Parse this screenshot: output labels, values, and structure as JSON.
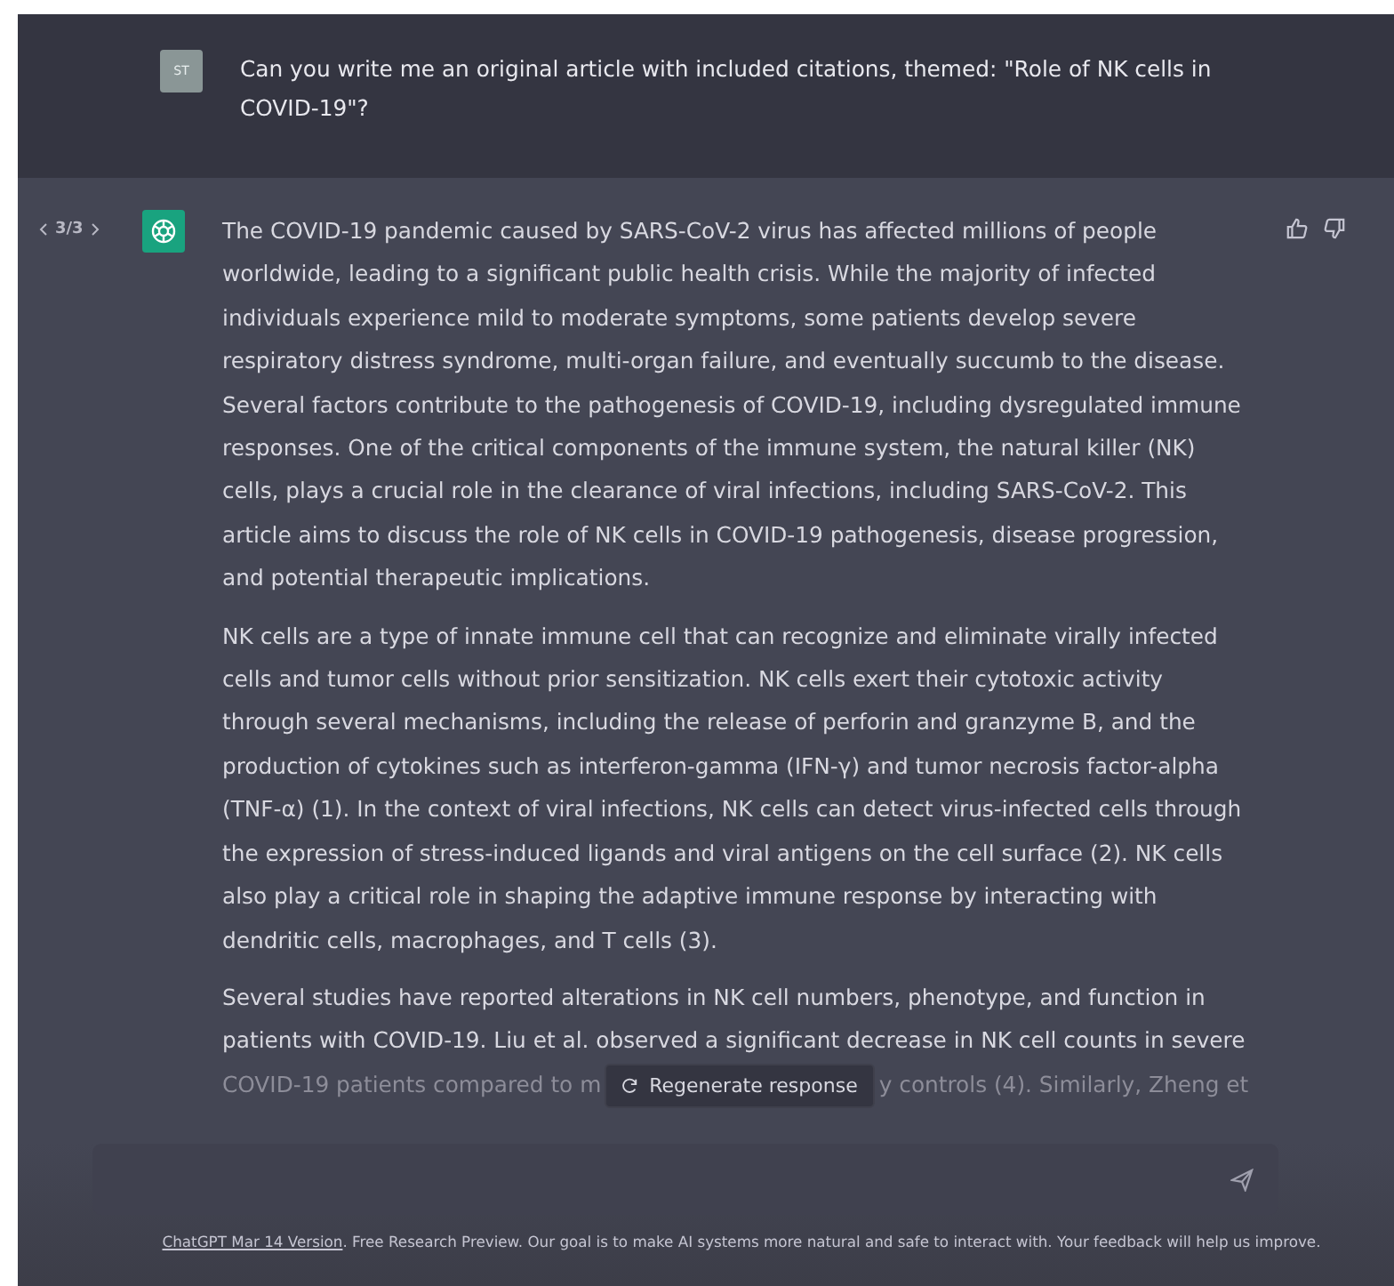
{
  "user_message": {
    "avatar": "ST",
    "text": "Can you write me an original article with included citations, themed: \"Role of NK cells in COVID-19\"?"
  },
  "assistant_message": {
    "pager": "3/3",
    "paragraphs": [
      "The COVID-19 pandemic caused by SARS-CoV-2 virus has affected millions of people worldwide, leading to a significant public health crisis. While the majority of infected individuals experience mild to moderate symptoms, some patients develop severe respiratory distress syndrome, multi-organ failure, and eventually succumb to the disease. Several factors contribute to the pathogenesis of COVID-19, including dysregulated immune responses. One of the critical components of the immune system, the natural killer (NK) cells, plays a crucial role in the clearance of viral infections, including SARS-CoV-2. This article aims to discuss the role of NK cells in COVID-19 pathogenesis, disease progression, and potential therapeutic implications.",
      "NK cells are a type of innate immune cell that can recognize and eliminate virally infected cells and tumor cells without prior sensitization. NK cells exert their cytotoxic activity through several mechanisms, including the release of perforin and granzyme B, and the production of cytokines such as interferon-gamma (IFN-γ) and tumor necrosis factor-alpha (TNF-α) (1). In the context of viral infections, NK cells can detect virus-infected cells through the expression of stress-induced ligands and viral antigens on the cell surface (2). NK cells also play a critical role in shaping the adaptive immune response by interacting with dendritic cells, macrophages, and T cells (3).",
      "Several studies have reported alterations in NK cell numbers, phenotype, and function in patients with COVID-19. Liu et al. observed a significant decrease in NK cell counts in severe"
    ],
    "faded_line": [
      "COVID-19 patients compared to m",
      "y controls (4). Similarly, Zheng et"
    ]
  },
  "regenerate_button": "Regenerate response",
  "footer": {
    "link": "ChatGPT Mar 14 Version",
    "text": ". Free Research Preview. Our goal is to make AI systems more natural and safe to interact with. Your feedback will help us improve."
  }
}
